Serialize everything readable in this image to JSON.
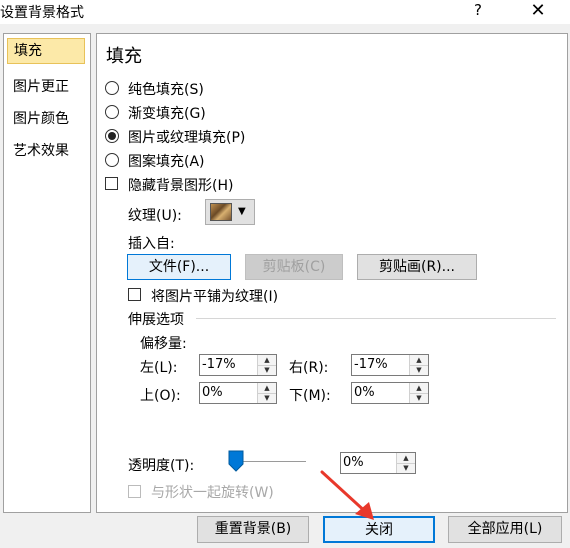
{
  "window": {
    "title": "设置背景格式",
    "help": "?",
    "close": "✕"
  },
  "nav": {
    "items": [
      {
        "label": "填充",
        "selected": true
      },
      {
        "label": "图片更正"
      },
      {
        "label": "图片颜色"
      },
      {
        "label": "艺术效果"
      }
    ]
  },
  "fill": {
    "heading": "填充",
    "options": [
      {
        "label": "纯色填充(S)",
        "checked": false
      },
      {
        "label": "渐变填充(G)",
        "checked": false
      },
      {
        "label": "图片或纹理填充(P)",
        "checked": true
      },
      {
        "label": "图案填充(A)",
        "checked": false
      }
    ],
    "hide_bg_label": "隐藏背景图形(H)",
    "texture_label": "纹理(U):",
    "insert_from_label": "插入自:",
    "buttons": {
      "file": "文件(F)...",
      "clipboard": "剪贴板(C)",
      "clipart": "剪贴画(R)..."
    },
    "tile_label": "将图片平铺为纹理(I)",
    "stretch_heading": "伸展选项",
    "offset_label": "偏移量:",
    "offsets": {
      "left": {
        "label": "左(L):",
        "value": "-17%"
      },
      "right": {
        "label": "右(R):",
        "value": "-17%"
      },
      "top": {
        "label": "上(O):",
        "value": "0%"
      },
      "bottom": {
        "label": "下(M):",
        "value": "0%"
      }
    },
    "transparency": {
      "label": "透明度(T):",
      "value": "0%",
      "level": 0
    },
    "rotate_label": "与形状一起旋转(W)"
  },
  "footer": {
    "reset": "重置背景(B)",
    "close": "关闭",
    "apply_all": "全部应用(L)"
  },
  "colors": {
    "accent": "#0078d7",
    "nav_selected": "#fce9a8",
    "arrow": "#e8382b"
  }
}
